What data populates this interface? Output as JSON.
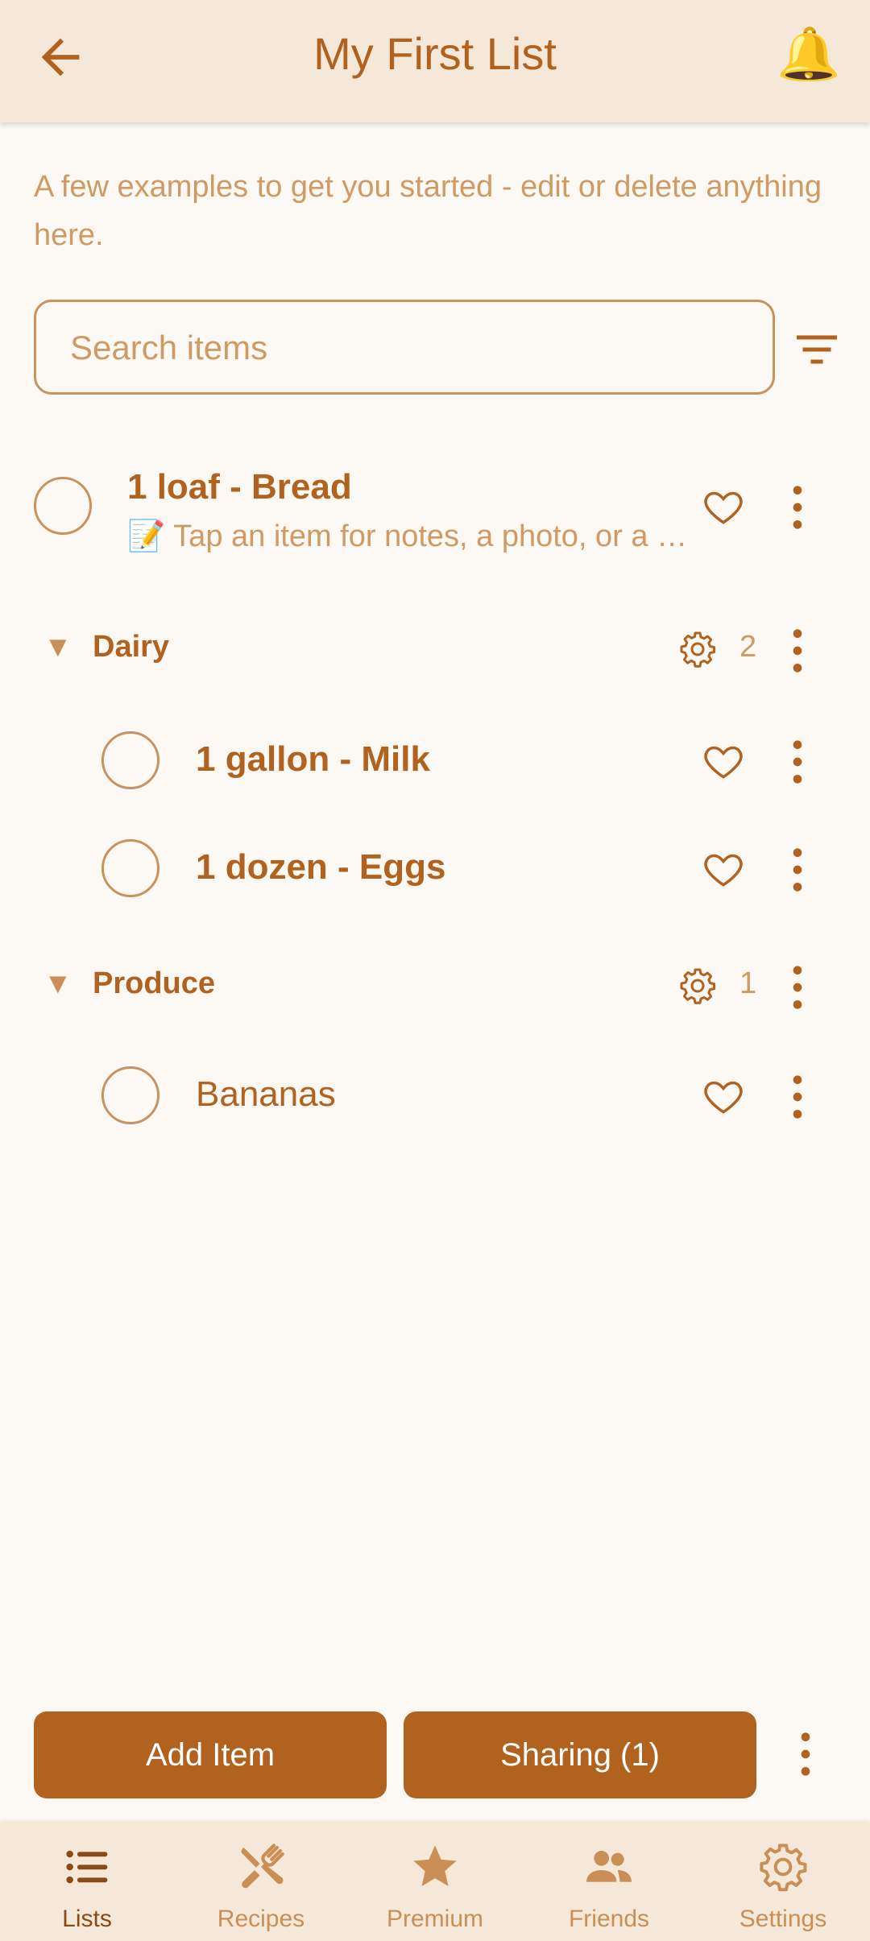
{
  "header": {
    "title": "My First List",
    "bell": "🔔"
  },
  "description": "A few examples to get you started - edit or delete anything here.",
  "search": {
    "placeholder": "Search items",
    "value": ""
  },
  "items_top": [
    {
      "title": "1 loaf - Bread",
      "note": "📝 Tap an item for notes, a photo, or a …"
    }
  ],
  "categories": [
    {
      "name": "Dairy",
      "count": "2",
      "arrow": "▼",
      "items": [
        {
          "title": "1 gallon - Milk"
        },
        {
          "title": "1 dozen - Eggs"
        }
      ]
    },
    {
      "name": "Produce",
      "count": "1",
      "arrow": "▼",
      "items": [
        {
          "title": "Bananas"
        }
      ]
    }
  ],
  "actions": {
    "add_item": "Add Item",
    "sharing": "Sharing (1)"
  },
  "nav": [
    {
      "label": "Lists",
      "icon": "list-icon",
      "active": true
    },
    {
      "label": "Recipes",
      "icon": "fork-knife-icon",
      "active": false
    },
    {
      "label": "Premium",
      "icon": "star-icon",
      "active": false
    },
    {
      "label": "Friends",
      "icon": "people-icon",
      "active": false
    },
    {
      "label": "Settings",
      "icon": "gear-icon",
      "active": false
    }
  ],
  "colors": {
    "accent": "#b1621f",
    "header_bg": "#f5e8d9",
    "page_bg": "#fcf8f4",
    "muted": "#cf9a63"
  }
}
